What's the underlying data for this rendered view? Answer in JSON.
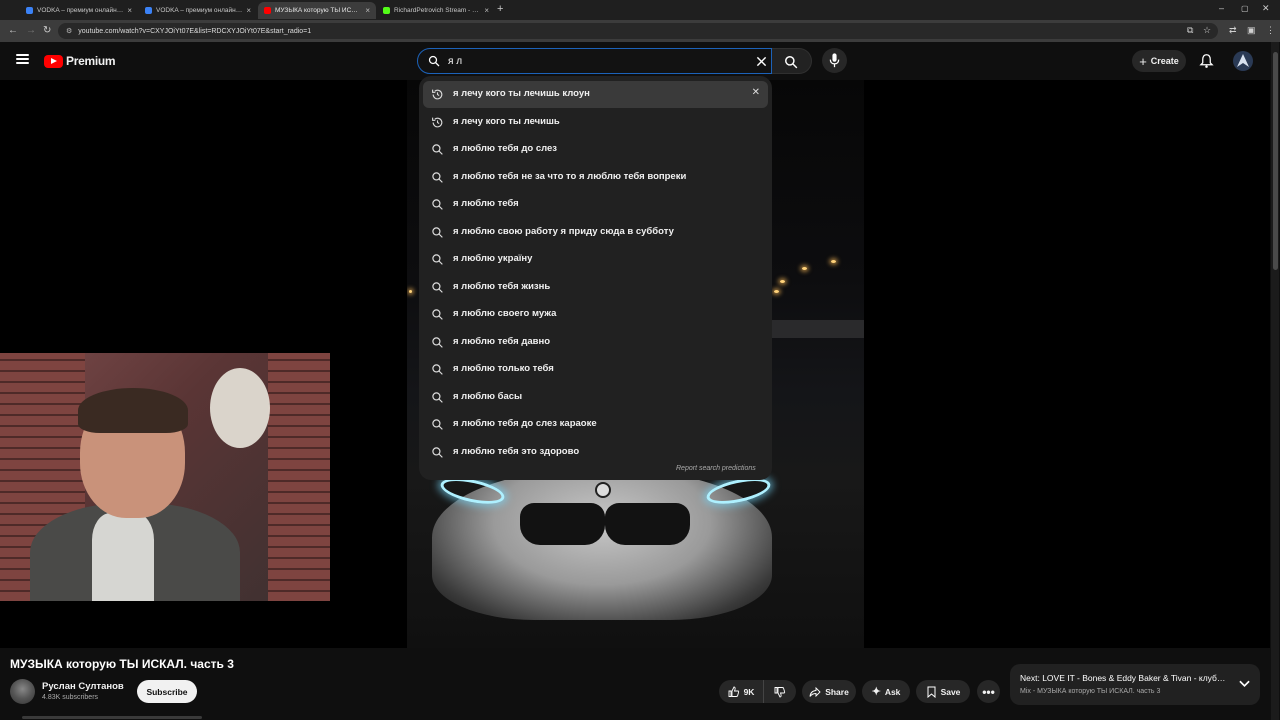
{
  "browser": {
    "tabs": [
      {
        "title": "VODKA – премиум онлайн-ка",
        "active": false,
        "favicon_color": "#3b82f6"
      },
      {
        "title": "VODKA – премиум онлайн-ка",
        "active": false,
        "favicon_color": "#3b82f6"
      },
      {
        "title": "МУЗЫКА которую ТЫ ИСКАЛ.",
        "active": true,
        "favicon_color": "#ff0000"
      },
      {
        "title": "RichardPetrovich Stream - Wat",
        "active": false,
        "favicon_color": "#53fc18"
      }
    ],
    "url": "youtube.com/watch?v=CXYJOiYt07E&list=RDCXYJOiYt07E&start_radio=1"
  },
  "header": {
    "brand": "Premium",
    "search_value": "я л",
    "create_label": "Create"
  },
  "suggestions": [
    {
      "text": "я лечу кого ты лечишь клоун",
      "type": "history",
      "highlighted": true
    },
    {
      "text": "я лечу кого ты лечишь",
      "type": "history",
      "highlighted": false
    },
    {
      "text": "я люблю тебя до слез",
      "type": "search",
      "highlighted": false
    },
    {
      "text": "я люблю тебя не за что то я люблю тебя вопреки",
      "type": "search",
      "highlighted": false
    },
    {
      "text": "я люблю тебя",
      "type": "search",
      "highlighted": false
    },
    {
      "text": "я люблю свою работу я приду сюда в субботу",
      "type": "search",
      "highlighted": false
    },
    {
      "text": "я люблю украïну",
      "type": "search",
      "highlighted": false
    },
    {
      "text": "я люблю тебя жизнь",
      "type": "search",
      "highlighted": false
    },
    {
      "text": "я люблю своего мужа",
      "type": "search",
      "highlighted": false
    },
    {
      "text": "я люблю тебя давно",
      "type": "search",
      "highlighted": false
    },
    {
      "text": "я люблю только тебя",
      "type": "search",
      "highlighted": false
    },
    {
      "text": "я люблю басы",
      "type": "search",
      "highlighted": false
    },
    {
      "text": "я люблю тебя до слез караоке",
      "type": "search",
      "highlighted": false
    },
    {
      "text": "я люблю тебя это здорово",
      "type": "search",
      "highlighted": false
    }
  ],
  "report_label": "Report search predictions",
  "video": {
    "title": "МУЗЫКА которую ТЫ ИСКАЛ. часть 3",
    "channel_name": "Руслан Султанов",
    "subscribers": "4.83K subscribers",
    "subscribe_label": "Subscribe",
    "likes": "9K",
    "share_label": "Share",
    "ask_label": "Ask",
    "save_label": "Save"
  },
  "next": {
    "line1": "Next: LOVE IT - Bones & Eddy Baker & Tivan - клубн...",
    "line2": "Mix - МУЗЫКА которую ТЫ ИСКАЛ. часть 3"
  },
  "colors": {
    "accent": "#ff0000",
    "search_border": "#1c62b9",
    "background": "#0f0f0f",
    "dropdown": "#212121"
  }
}
